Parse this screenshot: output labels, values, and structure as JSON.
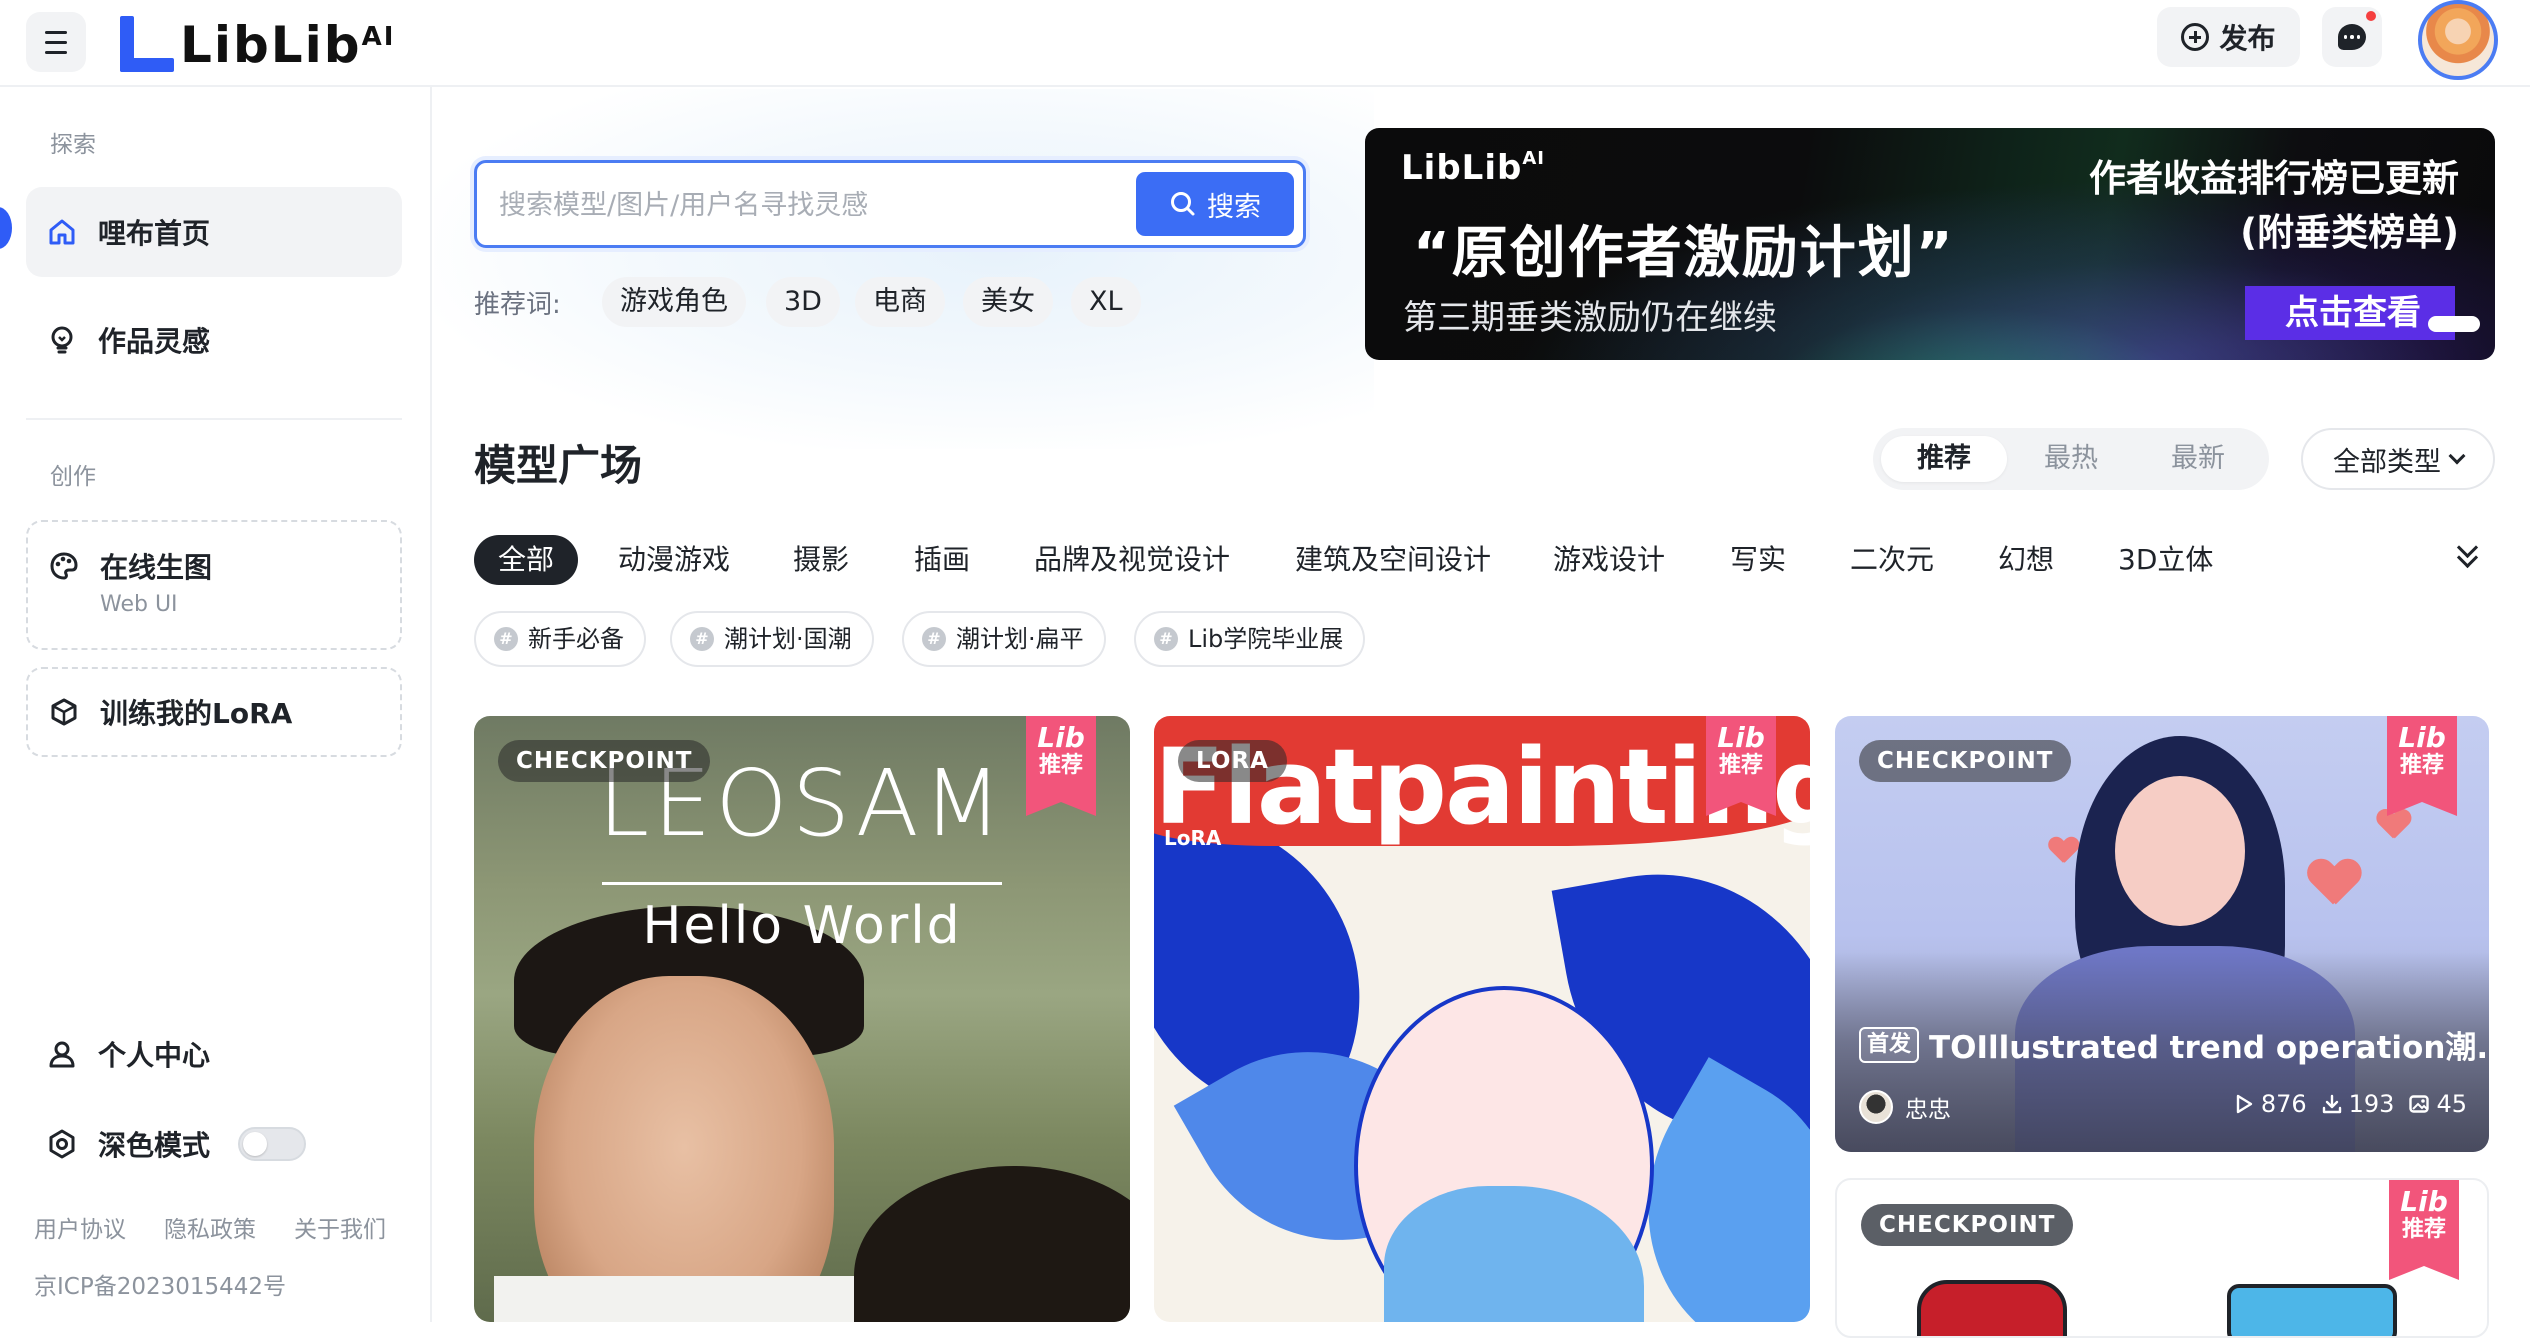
{
  "header": {
    "logo_text": "LibLib",
    "logo_ai": "AI",
    "publish_label": "发布"
  },
  "sidebar": {
    "section_explore": "探索",
    "home": "哩布首页",
    "inspiration": "作品灵感",
    "section_create": "创作",
    "online_gen": "在线生图",
    "online_gen_sub": "Web UI",
    "train_lora": "训练我的LoRA",
    "personal": "个人中心",
    "dark_mode": "深色模式",
    "footer_links": [
      "用户协议",
      "隐私政策",
      "关于我们"
    ],
    "icp": "京ICP备2023015442号"
  },
  "search": {
    "placeholder": "搜索模型/图片/用户名寻找灵感",
    "button": "搜索",
    "rec_label": "推荐词:",
    "rec_tags": [
      "游戏角色",
      "3D",
      "电商",
      "美女",
      "XL"
    ]
  },
  "banner": {
    "logo": "LibLib",
    "logo_ai": "AI",
    "title": "“原创作者激励计划”",
    "subtitle": "第三期垂类激励仍在继续",
    "right_line1": "作者收益排行榜已更新",
    "right_line2": "(附垂类榜单)",
    "cta": "点击查看"
  },
  "models": {
    "title": "模型广场",
    "sort": [
      "推荐",
      "最热",
      "最新"
    ],
    "type_select": "全部类型",
    "categories": [
      "全部",
      "动漫游戏",
      "摄影",
      "插画",
      "品牌及视觉设计",
      "建筑及空间设计",
      "游戏设计",
      "写实",
      "二次元",
      "幻想",
      "3D立体"
    ],
    "chips": [
      "新手必备",
      "潮计划·国潮",
      "潮计划·扁平",
      "Lib学院毕业展"
    ]
  },
  "cards": [
    {
      "tag": "CHECKPOINT",
      "ribbon_top": "Lib",
      "ribbon_bottom": "推荐",
      "overlay_title": "LEOSAM",
      "overlay_sub": "Hello World"
    },
    {
      "tag": "LORA",
      "ribbon_top": "Lib",
      "ribbon_bottom": "推荐",
      "overlay_title": "Flatpainting",
      "overlay_mini": "LoRA"
    },
    {
      "tag": "CHECKPOINT",
      "ribbon_top": "Lib",
      "ribbon_bottom": "推荐",
      "badge": "首发",
      "title": "TOIllustrated trend operation潮...",
      "author": "忠忠",
      "runs": "876",
      "downloads": "193",
      "images": "45"
    },
    {
      "tag": "CHECKPOINT",
      "ribbon_top": "Lib",
      "ribbon_bottom": "推荐"
    }
  ]
}
